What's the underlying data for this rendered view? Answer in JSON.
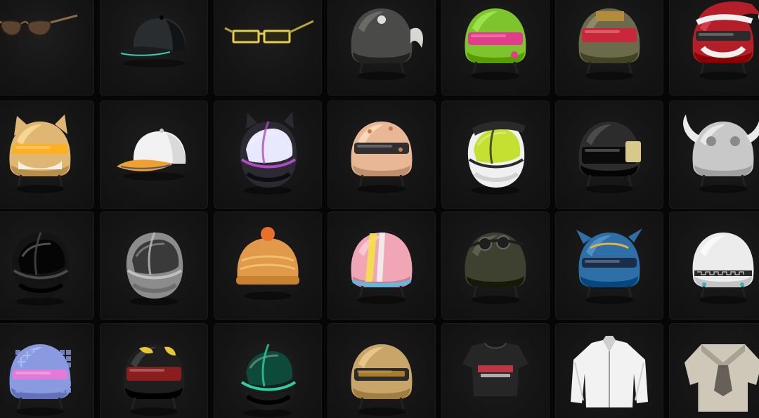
{
  "inventory": {
    "columns": 7,
    "items": [
      {
        "icon": "aviator-sunglasses-icon",
        "colors": {
          "primary": "#5a4330",
          "secondary": "#8a6a45",
          "accent": "#2a1e14"
        }
      },
      {
        "icon": "baseball-cap-icon",
        "colors": {
          "primary": "#2a2d30",
          "secondary": "#1a1c1e",
          "accent": "#3cc8b4"
        }
      },
      {
        "icon": "rectangle-sunglasses-icon",
        "colors": {
          "primary": "#b5a236",
          "secondary": "#2a2812",
          "accent": "#e3cf4a"
        }
      },
      {
        "icon": "winged-pilot-helmet-icon",
        "colors": {
          "primary": "#4a4a48",
          "secondary": "#d8d8d2",
          "accent": "#2a2a2a"
        }
      },
      {
        "icon": "lime-pink-level3-helmet-icon",
        "colors": {
          "primary": "#7ec42c",
          "secondary": "#e23d8a",
          "accent": "#f2f2f2"
        }
      },
      {
        "icon": "camo-goggle-helmet-icon",
        "colors": {
          "primary": "#6b6a4a",
          "secondary": "#c8283a",
          "accent": "#b48a3c"
        }
      },
      {
        "icon": "santa-helmet-icon",
        "colors": {
          "primary": "#b31e28",
          "secondary": "#f0f0f0",
          "accent": "#2b2b2b"
        }
      },
      {
        "icon": "cat-ear-level3-helmet-icon",
        "colors": {
          "primary": "#e0b772",
          "secondary": "#f5f0e6",
          "accent": "#ffb020"
        }
      },
      {
        "icon": "white-orange-cap-icon",
        "colors": {
          "primary": "#f2f2f2",
          "secondary": "#f0a030",
          "accent": "#4a5a78"
        }
      },
      {
        "icon": "cat-ear-visor-helmet-icon",
        "colors": {
          "primary": "#2a2a30",
          "secondary": "#b04ac8",
          "accent": "#e8e8ff"
        }
      },
      {
        "icon": "peach-level3-helmet-icon",
        "colors": {
          "primary": "#e8b896",
          "secondary": "#2f2f2f",
          "accent": "#c87a46"
        }
      },
      {
        "icon": "motocross-helmet-icon",
        "colors": {
          "primary": "#f0f0f0",
          "secondary": "#c6e032",
          "accent": "#2a2a2a"
        }
      },
      {
        "icon": "black-pcs-helmet-icon",
        "colors": {
          "primary": "#2c2c2c",
          "secondary": "#d8c88a",
          "accent": "#111111"
        }
      },
      {
        "icon": "viking-horned-helmet-icon",
        "colors": {
          "primary": "#c8c8c8",
          "secondary": "#eaeaea",
          "accent": "#8a8a8a"
        }
      },
      {
        "icon": "black-motorcycle-helmet-icon",
        "colors": {
          "primary": "#141414",
          "secondary": "#2e2e2e",
          "accent": "#4a4a4a"
        }
      },
      {
        "icon": "silver-motorcycle-helmet-icon",
        "colors": {
          "primary": "#8c8c8c",
          "secondary": "#3a3a3a",
          "accent": "#c0c0c0"
        }
      },
      {
        "icon": "beanie-with-pompom-icon",
        "colors": {
          "primary": "#e09a4a",
          "secondary": "#f0c070",
          "accent": "#e8702a"
        }
      },
      {
        "icon": "pastel-stripe-helmet-icon",
        "colors": {
          "primary": "#f0a6b4",
          "secondary": "#62b8e0",
          "accent": "#f5e04a"
        }
      },
      {
        "icon": "goggle-army-helmet-icon",
        "colors": {
          "primary": "#3e4030",
          "secondary": "#5a5c48",
          "accent": "#1e1e1e"
        }
      },
      {
        "icon": "blue-dragon-helmet-icon",
        "colors": {
          "primary": "#2e6fa8",
          "secondary": "#1a2e4a",
          "accent": "#e0b040"
        }
      },
      {
        "icon": "white-greek-pattern-helmet-icon",
        "colors": {
          "primary": "#ececec",
          "secondary": "#2a2a2a",
          "accent": "#3ab0b8"
        }
      },
      {
        "icon": "disco-ball-helmet-icon",
        "colors": {
          "primary": "#8a9ae0",
          "secondary": "#e47ad8",
          "accent": "#60e0e8"
        }
      },
      {
        "icon": "black-yellow-open-helmet-icon",
        "colors": {
          "primary": "#1e1e1e",
          "secondary": "#e6c832",
          "accent": "#8a1e1e"
        }
      },
      {
        "icon": "black-green-motorcycle-helmet-icon",
        "colors": {
          "primary": "#1a1a1a",
          "secondary": "#2ad0a0",
          "accent": "#0e4a3a"
        }
      },
      {
        "icon": "tan-level3-helmet-icon",
        "colors": {
          "primary": "#c8a66a",
          "secondary": "#2a2a2a",
          "accent": "#e0a02a"
        }
      },
      {
        "icon": "black-crop-top-icon",
        "colors": {
          "primary": "#262626",
          "secondary": "#d83a4a",
          "accent": "#e8e8e8"
        }
      },
      {
        "icon": "white-jacket-icon",
        "colors": {
          "primary": "#f2f2f2",
          "secondary": "#cfcfcf",
          "accent": "#9a9a9a"
        }
      },
      {
        "icon": "sailor-shirt-icon",
        "colors": {
          "primary": "#cfc8b8",
          "secondary": "#a8a294",
          "accent": "#4a4640"
        }
      }
    ]
  }
}
